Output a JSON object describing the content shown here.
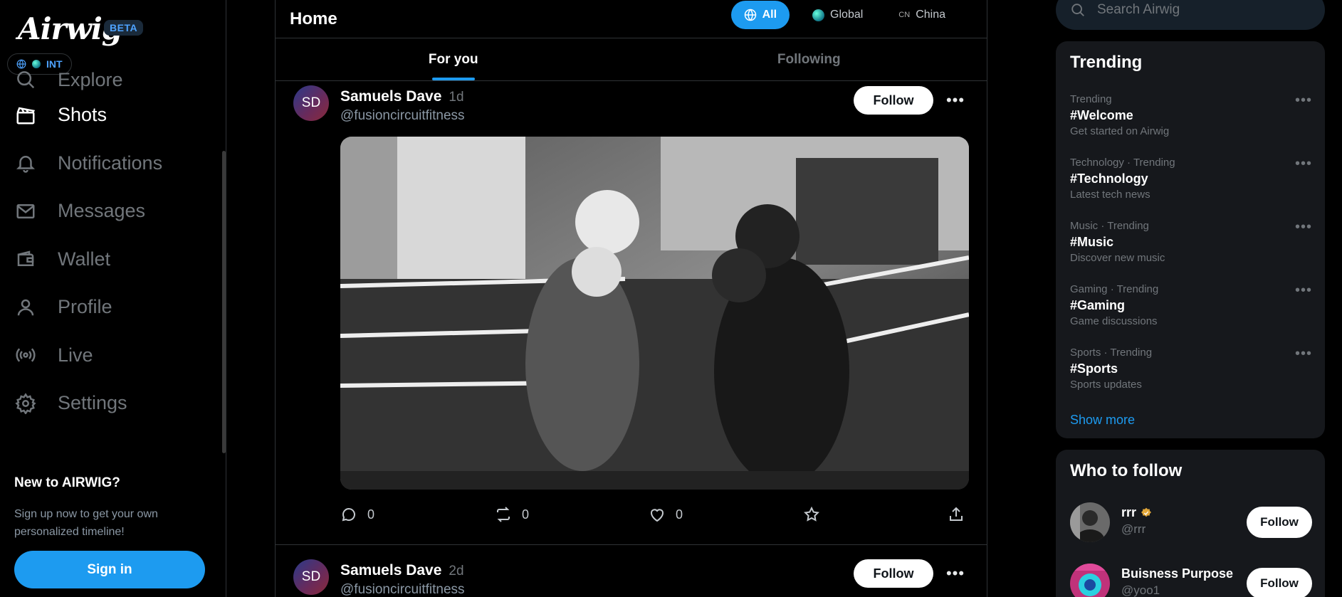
{
  "app": {
    "logo_text": "Airwig",
    "badge": "BETA",
    "region_label": "INT"
  },
  "sidebar": {
    "items": [
      {
        "label": "Explore",
        "icon": "search-icon"
      },
      {
        "label": "Shots",
        "icon": "clapperboard-icon"
      },
      {
        "label": "Notifications",
        "icon": "bell-icon"
      },
      {
        "label": "Messages",
        "icon": "mail-icon"
      },
      {
        "label": "Wallet",
        "icon": "wallet-icon"
      },
      {
        "label": "Profile",
        "icon": "person-icon"
      },
      {
        "label": "Live",
        "icon": "broadcast-icon"
      },
      {
        "label": "Settings",
        "icon": "gear-icon"
      }
    ],
    "new_heading": "New to AIRWIG?",
    "new_text": "Sign up now to get your own personalized timeline!",
    "signin_label": "Sign in"
  },
  "feed": {
    "title": "Home",
    "scopes": [
      {
        "label": "All",
        "active": true
      },
      {
        "label": "Global",
        "active": false
      },
      {
        "label": "China",
        "prefix": "CN",
        "active": false
      }
    ],
    "tabs": [
      {
        "label": "For you",
        "active": true
      },
      {
        "label": "Following",
        "active": false
      }
    ],
    "posts": [
      {
        "avatar_initials": "SD",
        "name": "Samuels Dave",
        "time": "1d",
        "handle": "@fusioncircuitfitness",
        "follow_label": "Follow",
        "replies": "0",
        "reposts": "0",
        "likes": "0"
      },
      {
        "avatar_initials": "SD",
        "name": "Samuels Dave",
        "time": "2d",
        "handle": "@fusioncircuitfitness",
        "follow_label": "Follow"
      }
    ]
  },
  "right": {
    "search_placeholder": "Search Airwig",
    "trending_title": "Trending",
    "trends": [
      {
        "category": "Trending",
        "tag": "#Welcome",
        "desc": "Get started on Airwig"
      },
      {
        "category": "Technology · Trending",
        "tag": "#Technology",
        "desc": "Latest tech news"
      },
      {
        "category": "Music · Trending",
        "tag": "#Music",
        "desc": "Discover new music"
      },
      {
        "category": "Gaming · Trending",
        "tag": "#Gaming",
        "desc": "Game discussions"
      },
      {
        "category": "Sports · Trending",
        "tag": "#Sports",
        "desc": "Sports updates"
      }
    ],
    "show_more": "Show more",
    "wtf_title": "Who to follow",
    "suggestions": [
      {
        "name": "rrr",
        "handle": "@rrr",
        "verified": true,
        "follow_label": "Follow"
      },
      {
        "name": "Buisness Purpose",
        "handle": "@yoo1",
        "verified": false,
        "follow_label": "Follow"
      }
    ]
  },
  "colors": {
    "accent": "#1d9bf0",
    "background": "#000000",
    "panel": "#16181c",
    "muted_text": "#71767b"
  }
}
